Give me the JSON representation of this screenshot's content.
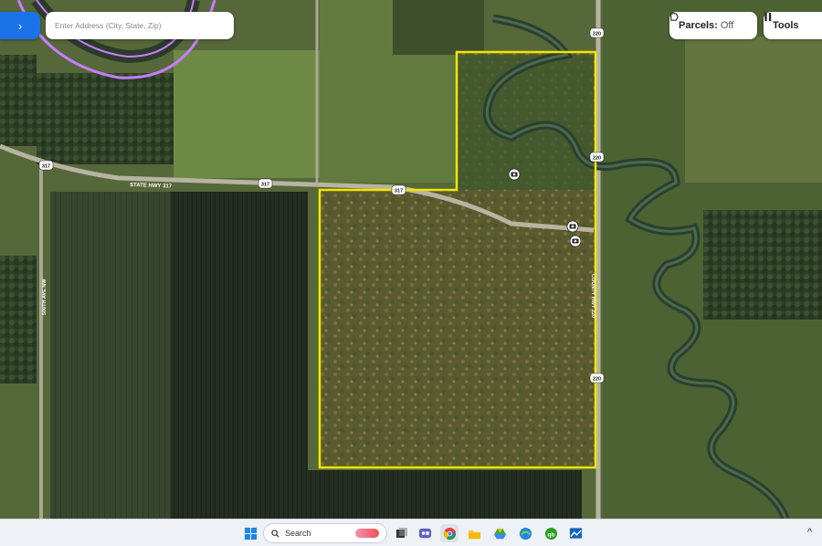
{
  "map": {
    "roads": {
      "highway_name": "STATE HWY 317",
      "avenue_name": "500TH AVE NW",
      "side_road_name": "COUNTY HWY 220"
    },
    "shields": [
      "317",
      "317",
      "317",
      "220",
      "220",
      "220"
    ],
    "colors": {
      "parcel_outline": "#f2e600",
      "route_highlight": "#c77dff",
      "shield_fill": "#ffffff"
    }
  },
  "toolbar": {
    "nav_toggle_icon": "›",
    "address_placeholder": "Enter Address (City, State, Zip)",
    "parcels_label": "Parcels:",
    "parcels_state": "Off",
    "tools_label": "Tools"
  },
  "taskbar": {
    "search_placeholder": "Search",
    "apps": [
      "windows-start-icon",
      "file-explorer-icon",
      "teams-icon",
      "chrome-icon",
      "folder-icon",
      "drive-icon",
      "maps-icon",
      "quickbooks-icon",
      "screen-capture-icon"
    ],
    "tray_chevron": "^"
  }
}
